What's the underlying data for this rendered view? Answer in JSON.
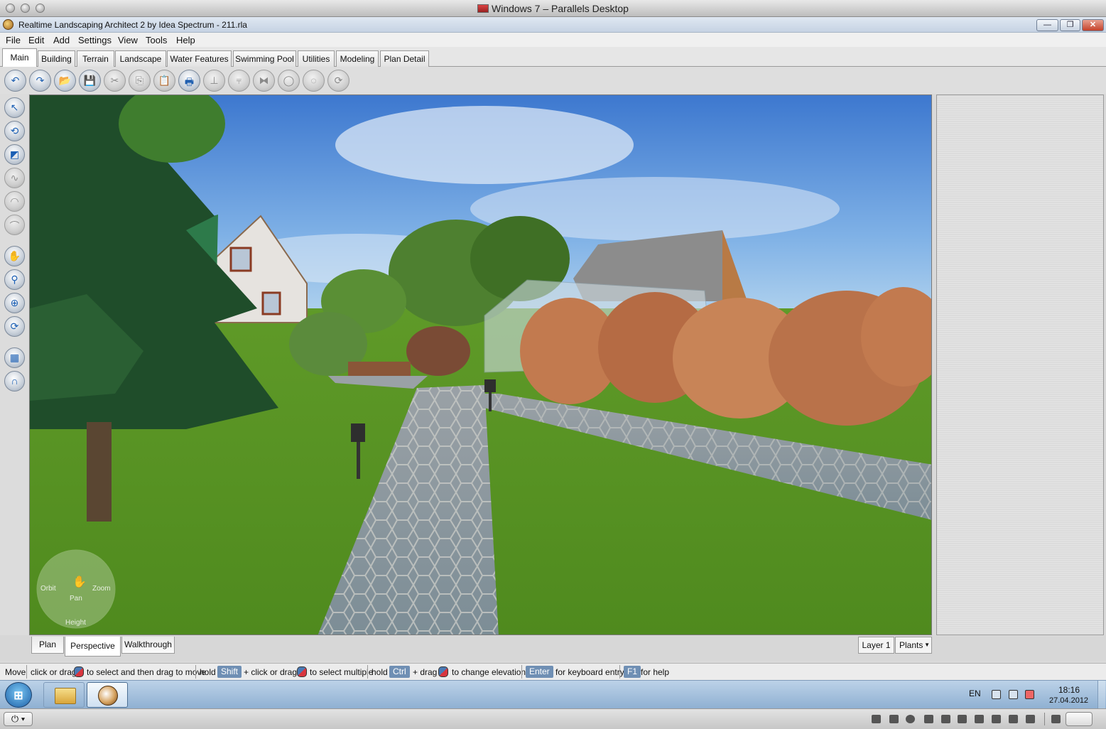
{
  "host": {
    "title": "Windows 7 – Parallels Desktop",
    "traffic_lights": [
      "close-light",
      "minimize-light",
      "zoom-light"
    ]
  },
  "window": {
    "title": "Realtime Landscaping Architect 2 by Idea Spectrum - 211.rla",
    "minimize_glyph": "—",
    "maximize_glyph": "❐",
    "close_glyph": "✕"
  },
  "menu": [
    "File",
    "Edit",
    "Add",
    "Settings",
    "View",
    "Tools",
    "Help"
  ],
  "tabs": [
    "Main",
    "Building",
    "Terrain",
    "Landscape",
    "Water Features",
    "Swimming Pool",
    "Utilities",
    "Modeling",
    "Plan Detail"
  ],
  "active_tab": "Main",
  "toolbar_icons": [
    {
      "name": "undo-icon",
      "glyph": "↶",
      "enabled": true
    },
    {
      "name": "redo-icon",
      "glyph": "↷",
      "enabled": true
    },
    {
      "name": "open-folder-icon",
      "glyph": "📂",
      "enabled": true
    },
    {
      "name": "save-icon",
      "glyph": "💾",
      "enabled": true
    },
    {
      "name": "cut-icon",
      "glyph": "✂",
      "enabled": false
    },
    {
      "name": "copy-icon",
      "glyph": "⎘",
      "enabled": false
    },
    {
      "name": "paste-icon",
      "glyph": "📋",
      "enabled": false
    },
    {
      "name": "print-icon",
      "glyph": "🖶",
      "enabled": true
    },
    {
      "name": "align-icon",
      "glyph": "⊥",
      "enabled": false
    },
    {
      "name": "distribute-icon",
      "glyph": "⫧",
      "enabled": false
    },
    {
      "name": "mirror-icon",
      "glyph": "⧓",
      "enabled": false
    },
    {
      "name": "group-icon",
      "glyph": "◯",
      "enabled": false
    },
    {
      "name": "ungroup-icon",
      "glyph": "◌",
      "enabled": false
    },
    {
      "name": "rotate-icon",
      "glyph": "⟳",
      "enabled": false
    }
  ],
  "left_tools": [
    {
      "name": "select-arrow-icon",
      "glyph": "↖",
      "enabled": true
    },
    {
      "name": "lasso-select-icon",
      "glyph": "⟲",
      "enabled": true
    },
    {
      "name": "resize-select-icon",
      "glyph": "◩",
      "enabled": true
    },
    {
      "name": "edit-curve-icon",
      "glyph": "∿",
      "enabled": false
    },
    {
      "name": "edit-arc-icon",
      "glyph": "◠",
      "enabled": false
    },
    {
      "name": "edit-shape-icon",
      "glyph": "⌒",
      "enabled": false
    },
    {
      "name": "pan-hand-icon",
      "glyph": "✋",
      "enabled": true
    },
    {
      "name": "zoom-magnifier-icon",
      "glyph": "⚲",
      "enabled": true
    },
    {
      "name": "zoom-fit-icon",
      "glyph": "⊕",
      "enabled": true
    },
    {
      "name": "orbit-icon",
      "glyph": "⟳",
      "enabled": true
    },
    {
      "name": "grid-icon",
      "glyph": "▦",
      "enabled": true
    },
    {
      "name": "magnet-snap-icon",
      "glyph": "∩",
      "enabled": true
    }
  ],
  "navigator": {
    "orbit": "Orbit",
    "zoom": "Zoom",
    "pan": "Pan",
    "height": "Height"
  },
  "view_tabs": [
    "Plan",
    "Perspective",
    "Walkthrough"
  ],
  "active_view": "Perspective",
  "layer": "Layer 1",
  "category_select": "Plants",
  "status": {
    "mode": "Move",
    "t1": "click or drag",
    "t2": "to select and then drag to move",
    "t3": "hold",
    "key_shift": "Shift",
    "t4": "+ click or drag",
    "t5": "to select multiple",
    "t6": "hold",
    "key_ctrl": "Ctrl",
    "t7": "+ drag",
    "t8": "to change elevation",
    "key_enter": "Enter",
    "t9": "for keyboard entry",
    "key_f1": "F1",
    "t10": "for help"
  },
  "taskbar": {
    "language": "EN",
    "time": "18:16",
    "date": "27.04.2012"
  },
  "colors": {
    "sky": "#5d93d8",
    "grass": "#5f9a28",
    "path": "#8b949c",
    "shrub": "#c27a4f",
    "key_bg": "#6f8fb4"
  }
}
